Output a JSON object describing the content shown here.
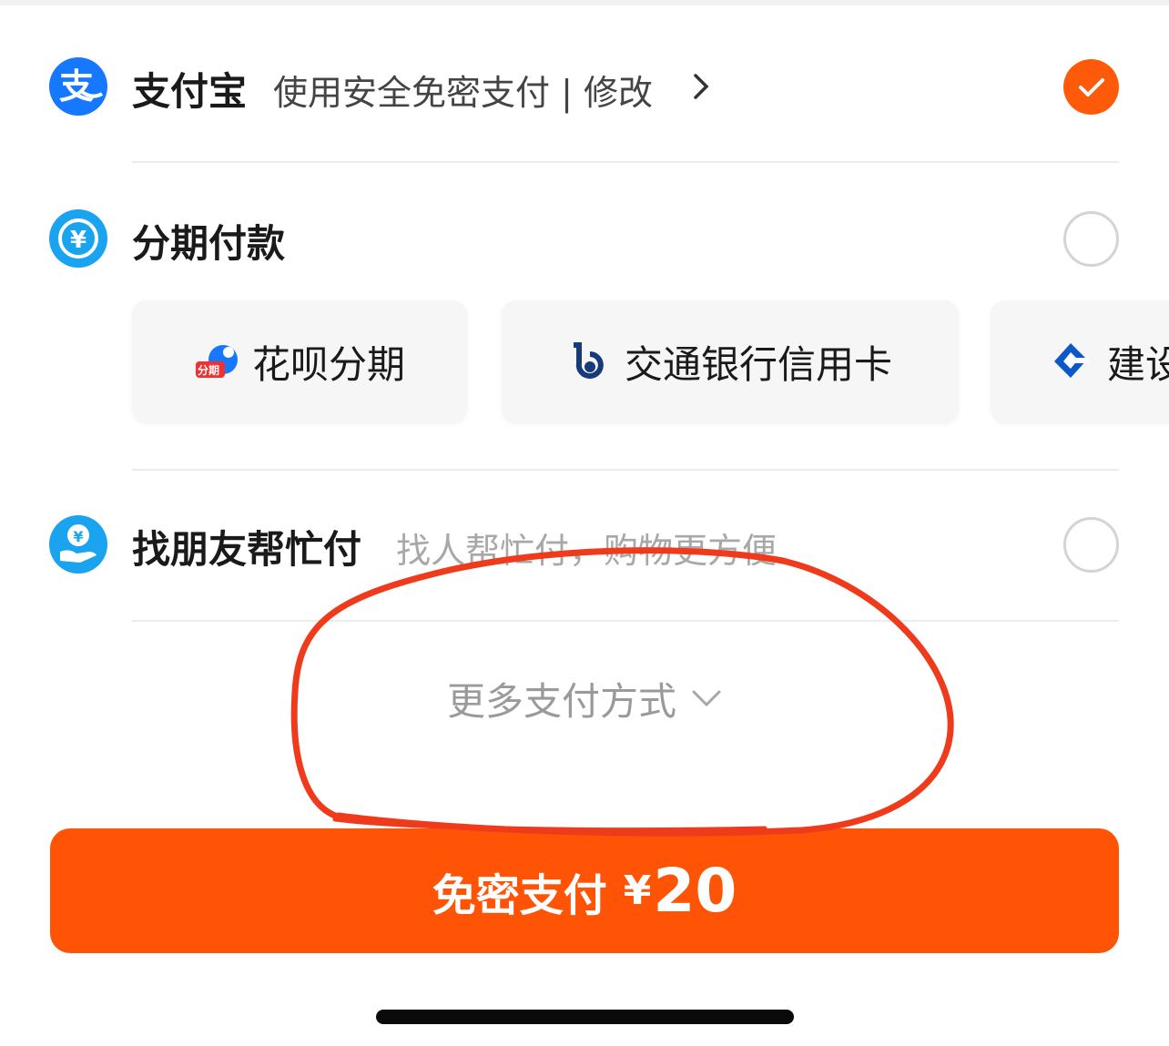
{
  "payment_methods": {
    "alipay": {
      "icon": "alipay-icon",
      "title": "支付宝",
      "subtitle": "使用安全免密支付 | 修改",
      "selected": true
    },
    "installment": {
      "icon": "installment-yen-icon",
      "title": "分期付款",
      "selected": false,
      "options": [
        {
          "icon": "huabei-icon",
          "badge": "分期",
          "label": "花呗分期"
        },
        {
          "icon": "bocom-icon",
          "label": "交通银行信用卡"
        },
        {
          "icon": "ccb-icon",
          "label": "建设"
        }
      ]
    },
    "friend_pay": {
      "icon": "friend-pay-hand-icon",
      "title": "找朋友帮忙付",
      "subtitle": "找人帮忙付，购物更方便",
      "selected": false
    }
  },
  "more": {
    "label": "更多支付方式"
  },
  "pay_button": {
    "label": "免密支付",
    "currency": "¥",
    "amount": "20"
  },
  "colors": {
    "accent": "#ff5306",
    "check": "#ff5a0a",
    "alipay_blue": "#1677ff",
    "annotation_red": "#f03a1a"
  }
}
